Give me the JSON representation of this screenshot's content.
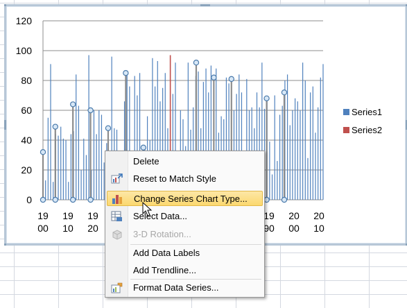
{
  "chart_data": {
    "type": "line",
    "description_free": true,
    "yticks": [
      "0",
      "20",
      "40",
      "60",
      "80",
      "100",
      "120"
    ],
    "ylim": [
      0,
      120
    ],
    "xlim": [
      1900,
      2010
    ],
    "xtick_labels": [
      {
        "line1": "19",
        "line2": "00"
      },
      {
        "line1": "19",
        "line2": "10"
      },
      {
        "line1": "19",
        "line2": "20"
      },
      {
        "line1": "19",
        "line2": "90"
      },
      {
        "line1": "20",
        "line2": "00"
      },
      {
        "line1": "20",
        "line2": "10"
      }
    ],
    "series": [
      {
        "name": "Series1",
        "color": "#4f81bd",
        "x": [
          1900,
          1901,
          1902,
          1903,
          1904,
          1905,
          1906,
          1907,
          1908,
          1909,
          1910,
          1911,
          1912,
          1913,
          1914,
          1915,
          1916,
          1917,
          1918,
          1919,
          1920,
          1921,
          1922,
          1923,
          1924,
          1925,
          1926,
          1927,
          1928,
          1929,
          1930,
          1931,
          1932,
          1933,
          1934,
          1935,
          1936,
          1937,
          1938,
          1939,
          1940,
          1941,
          1942,
          1943,
          1944,
          1945,
          1946,
          1947,
          1948,
          1949,
          1950,
          1951,
          1952,
          1953,
          1954,
          1955,
          1956,
          1957,
          1958,
          1959,
          1960,
          1961,
          1962,
          1963,
          1964,
          1965,
          1966,
          1967,
          1968,
          1969,
          1970,
          1971,
          1972,
          1973,
          1974,
          1975,
          1976,
          1977,
          1978,
          1979,
          1980,
          1981,
          1982,
          1983,
          1984,
          1985,
          1986,
          1987,
          1988,
          1989,
          1990,
          1991,
          1992,
          1993,
          1994,
          1995,
          1996,
          1997,
          1998,
          1999,
          2000,
          2001,
          2002,
          2003,
          2004,
          2005,
          2006,
          2007,
          2008,
          2009,
          2010
        ],
        "values": [
          32,
          13,
          55,
          91,
          12,
          44,
          43,
          49,
          41,
          40,
          12,
          44,
          46,
          84,
          63,
          20,
          41,
          30,
          97,
          20,
          60,
          44,
          60,
          57,
          25,
          38,
          12,
          96,
          48,
          47,
          8,
          24,
          66,
          84,
          76,
          17,
          83,
          70,
          85,
          14,
          34,
          56,
          40,
          95,
          76,
          93,
          66,
          75,
          85,
          48,
          56,
          71,
          92,
          25,
          60,
          54,
          36,
          92,
          47,
          62,
          83,
          86,
          48,
          79,
          88,
          72,
          90,
          52,
          88,
          45,
          56,
          54,
          82,
          78,
          40,
          60,
          71,
          84,
          72,
          33,
          81,
          60,
          62,
          48,
          72,
          62,
          92,
          61,
          69,
          39,
          17,
          70,
          26,
          57,
          63,
          80,
          84,
          50,
          60,
          68,
          66,
          60,
          92,
          80,
          28,
          72,
          76,
          45,
          62,
          82,
          91
        ]
      },
      {
        "name": "Series2",
        "color": "#c0504d",
        "x": [
          1950
        ],
        "values": [
          97
        ]
      }
    ],
    "markers": [
      {
        "x": 1900,
        "y": 32
      },
      {
        "x": 1907,
        "y": 49
      },
      {
        "x": 1917,
        "y": 64
      },
      {
        "x": 1927,
        "y": 60
      },
      {
        "x": 1937,
        "y": 48
      },
      {
        "x": 1947,
        "y": 85
      },
      {
        "x": 1957,
        "y": 35
      },
      {
        "x": 1987,
        "y": 92
      },
      {
        "x": 1997,
        "y": 82
      },
      {
        "x": 2007,
        "y": 81
      },
      {
        "x": 2017,
        "y": 17
      },
      {
        "x": 2027,
        "y": 68
      },
      {
        "x": 2037,
        "y": 72
      }
    ],
    "legend": [
      "Series1",
      "Series2"
    ],
    "legend_position": "right",
    "grid": true
  },
  "context_menu": {
    "items": [
      {
        "label": "Delete",
        "icon": "none",
        "disabled": false,
        "highlight": false
      },
      {
        "label": "Reset to Match Style",
        "icon": "reset-style-icon",
        "disabled": false,
        "highlight": false
      },
      {
        "label": "Change Series Chart Type...",
        "icon": "chart-type-icon",
        "disabled": false,
        "highlight": true
      },
      {
        "label": "Select Data...",
        "icon": "select-data-icon",
        "disabled": false,
        "highlight": false
      },
      {
        "label": "3-D Rotation...",
        "icon": "rotation-3d-icon",
        "disabled": true,
        "highlight": false
      },
      {
        "label": "Add Data Labels",
        "icon": "none",
        "disabled": false,
        "highlight": false
      },
      {
        "label": "Add Trendline...",
        "icon": "none",
        "disabled": false,
        "highlight": false
      },
      {
        "label": "Format Data Series...",
        "icon": "format-series-icon",
        "disabled": false,
        "highlight": false
      }
    ]
  }
}
